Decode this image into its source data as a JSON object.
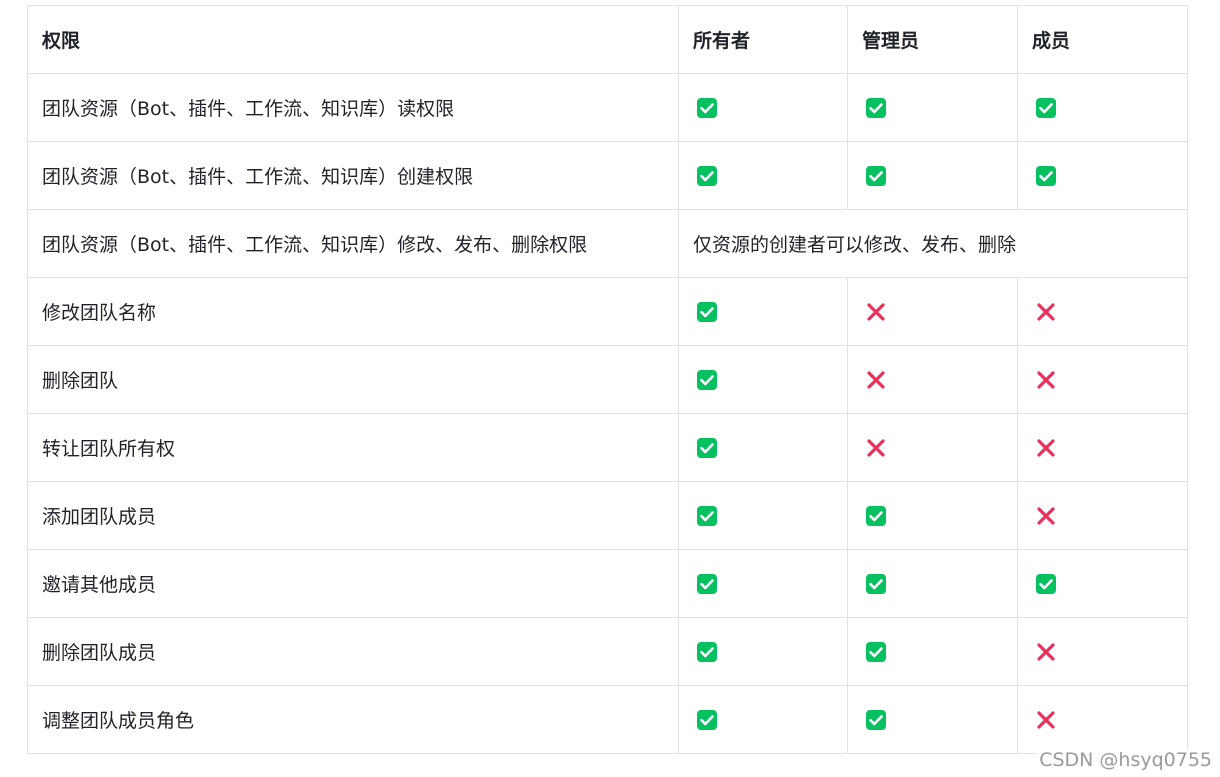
{
  "table": {
    "headers": [
      "权限",
      "所有者",
      "管理员",
      "成员"
    ],
    "rows": [
      {
        "permission": "团队资源（Bot、插件、工作流、知识库）读权限",
        "owner": "check",
        "admin": "check",
        "member": "check"
      },
      {
        "permission": "团队资源（Bot、插件、工作流、知识库）创建权限",
        "owner": "check",
        "admin": "check",
        "member": "check"
      },
      {
        "permission": "团队资源（Bot、插件、工作流、知识库）修改、发布、删除权限",
        "note": "仅资源的创建者可以修改、发布、删除"
      },
      {
        "permission": "修改团队名称",
        "owner": "check",
        "admin": "cross",
        "member": "cross"
      },
      {
        "permission": "删除团队",
        "owner": "check",
        "admin": "cross",
        "member": "cross"
      },
      {
        "permission": "转让团队所有权",
        "owner": "check",
        "admin": "cross",
        "member": "cross"
      },
      {
        "permission": "添加团队成员",
        "owner": "check",
        "admin": "check",
        "member": "cross"
      },
      {
        "permission": "邀请其他成员",
        "owner": "check",
        "admin": "check",
        "member": "check"
      },
      {
        "permission": "删除团队成员",
        "owner": "check",
        "admin": "check",
        "member": "cross"
      },
      {
        "permission": "调整团队成员角色",
        "owner": "check",
        "admin": "check",
        "member": "cross"
      }
    ]
  },
  "icons": {
    "check": {
      "name": "check-box-icon",
      "color": "#07c160"
    },
    "cross": {
      "name": "cross-icon",
      "color": "#e8305a"
    }
  },
  "watermark": "CSDN @hsyq0755"
}
